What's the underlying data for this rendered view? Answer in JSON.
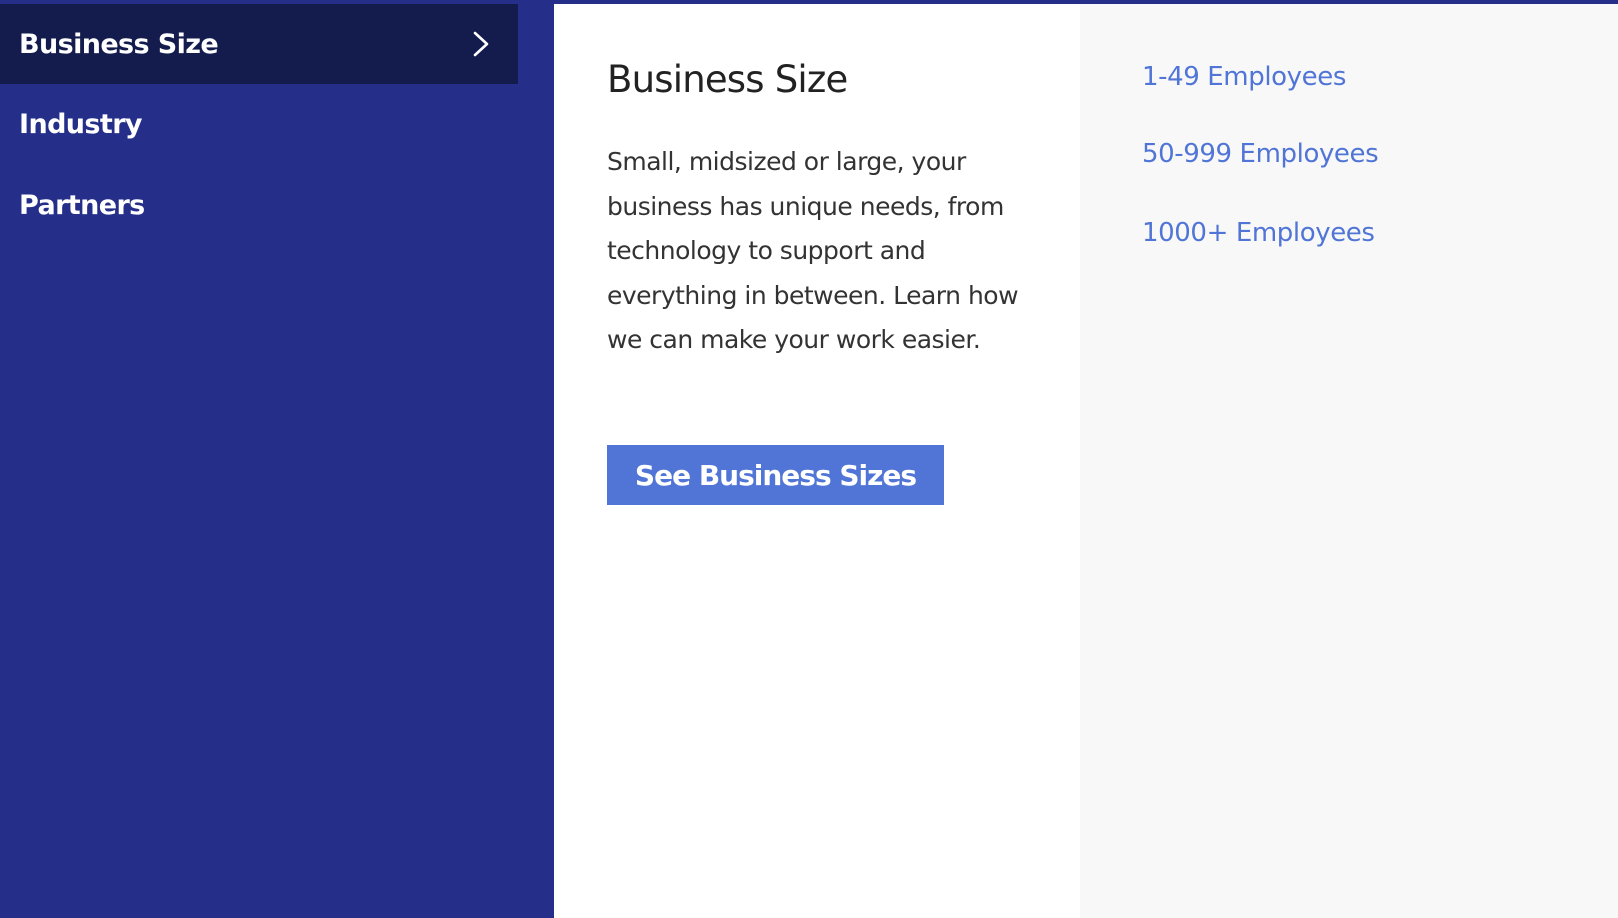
{
  "sidebar": {
    "items": [
      {
        "label": "Business Size",
        "active": true,
        "icon": "chevron-right-icon"
      },
      {
        "label": "Industry",
        "active": false
      },
      {
        "label": "Partners",
        "active": false
      }
    ]
  },
  "main": {
    "title": "Business Size",
    "description": "Small, midsized or large, your business has unique needs, from technology to support and everything in between. Learn how we can make your work easier.",
    "cta_label": "See Business Sizes"
  },
  "links": [
    {
      "label": "1-49 Employees"
    },
    {
      "label": "50-999 Employees"
    },
    {
      "label": "1000+ Employees"
    }
  ],
  "colors": {
    "sidebar_bg": "#252f8a",
    "sidebar_active_bg": "#141c4e",
    "accent": "#5075d6",
    "main_bg": "#ffffff",
    "right_bg": "#f8f8f8",
    "title_text": "#222222",
    "body_text": "#333333"
  }
}
